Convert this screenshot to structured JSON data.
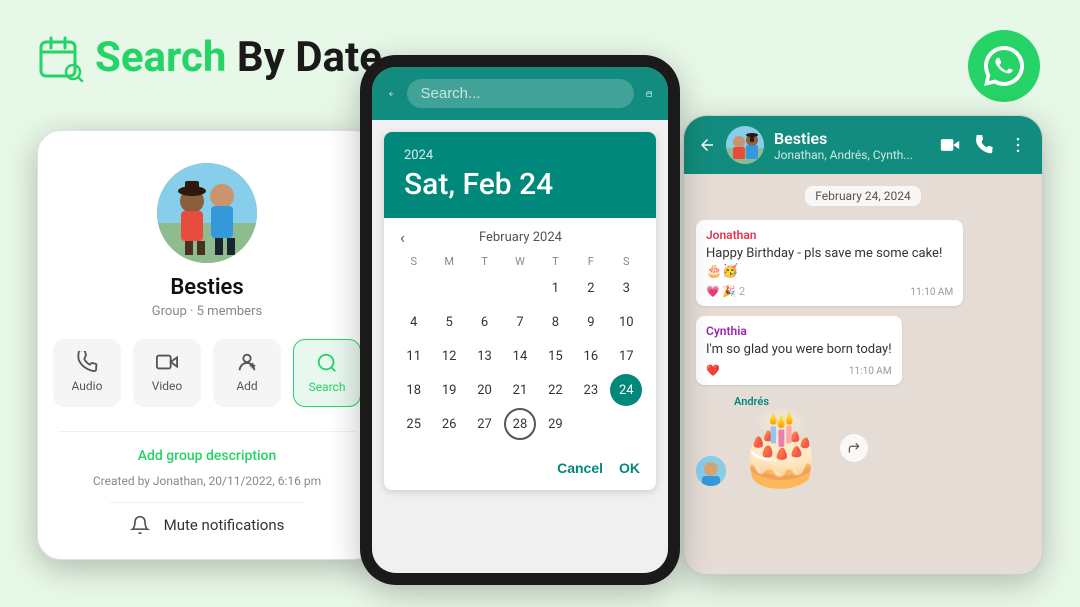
{
  "title": {
    "green_part": "Search",
    "rest_part": " By Date"
  },
  "group": {
    "name": "Besties",
    "meta": "Group · 5 members",
    "description": "Add group description",
    "created": "Created by Jonathan, 20/11/2022, 6:16 pm",
    "mute": "Mute notifications",
    "actions": [
      "Audio",
      "Video",
      "Add",
      "Search"
    ]
  },
  "calendar": {
    "year": "2024",
    "date_display": "Sat, Feb 24",
    "month_nav": "February 2024",
    "days_of_week": [
      "S",
      "M",
      "T",
      "W",
      "T",
      "F",
      "S"
    ],
    "selected_day": 24,
    "circled_day": 28,
    "cancel_label": "Cancel",
    "ok_label": "OK",
    "search_placeholder": "Search..."
  },
  "chat": {
    "title": "Besties",
    "subtitle": "Jonathan, Andrés, Cynth...",
    "date_label": "February 24, 2024",
    "messages": [
      {
        "sender": "Jonathan",
        "color": "jonathan",
        "text": "Happy Birthday - pls save me some cake! 🎂🥳",
        "time": "11:10 AM",
        "reactions": "💗 🎉 2"
      },
      {
        "sender": "Cynthia",
        "color": "cynthia",
        "text": "I'm so glad you were born today!",
        "time": "11:10 AM",
        "reactions": "❤️"
      },
      {
        "sender": "Andrés",
        "color": "andres",
        "text": "🎂",
        "time": "",
        "reactions": ""
      }
    ]
  }
}
